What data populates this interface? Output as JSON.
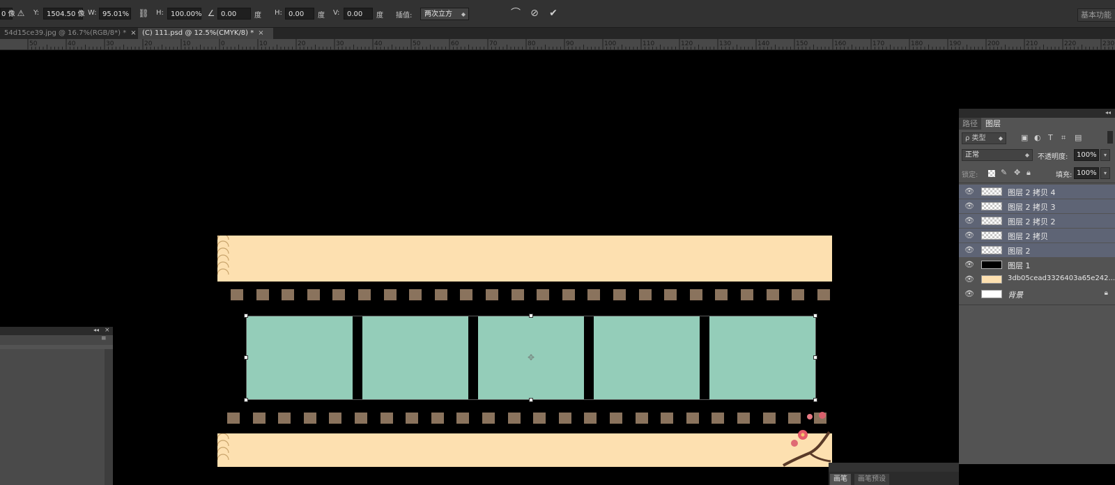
{
  "options_bar": {
    "x_partial": "0 像",
    "y_label": "Y:",
    "y_value": "1504.50 像",
    "w_label": "W:",
    "w_value": "95.01%",
    "h_label": "H:",
    "h_value": "100.00%",
    "angle_value": "0.00",
    "angle_unit": "度",
    "hskew_label": "H:",
    "hskew_value": "0.00",
    "hskew_unit": "度",
    "vskew_label": "V:",
    "vskew_value": "0.00",
    "vskew_unit": "度",
    "interp_label": "插值:",
    "interp_value": "两次立方",
    "workspace": "基本功能"
  },
  "tabs": [
    {
      "label": "54d15ce39.jpg @ 16.7%(RGB/8*) *",
      "active": false
    },
    {
      "label": "(C) 111.psd @ 12.5%(CMYK/8) *",
      "active": true
    }
  ],
  "ruler": {
    "labels": [
      "50",
      "40",
      "30",
      "20",
      "10",
      "0",
      "10",
      "20",
      "30",
      "40",
      "50",
      "60",
      "70",
      "80",
      "90",
      "100",
      "110",
      "120",
      "130",
      "140",
      "150",
      "160",
      "170",
      "180",
      "190",
      "200",
      "210",
      "220",
      "230"
    ]
  },
  "layers_panel": {
    "tabs": [
      "路径",
      "图层"
    ],
    "active_tab": "图层",
    "filter_label": "ρ 类型",
    "blend_mode": "正常",
    "opacity_label": "不透明度:",
    "opacity_value": "100%",
    "lock_label": "锁定:",
    "fill_label": "填充:",
    "fill_value": "100%",
    "layers": [
      {
        "name": "图层 2 拷贝 4",
        "selected": true,
        "thumb": "checker"
      },
      {
        "name": "图层 2 拷贝 3",
        "selected": true,
        "thumb": "checker"
      },
      {
        "name": "图层 2 拷贝 2",
        "selected": true,
        "thumb": "checker"
      },
      {
        "name": "图层 2 拷贝",
        "selected": true,
        "thumb": "checker"
      },
      {
        "name": "图层 2",
        "selected": true,
        "thumb": "checker"
      },
      {
        "name": "图层 1",
        "selected": false,
        "thumb": "film"
      },
      {
        "name": "3db05cead3326403a65e242...",
        "selected": false,
        "thumb": "peach"
      },
      {
        "name": "背景",
        "selected": false,
        "thumb": "white",
        "locked": true
      }
    ]
  },
  "brush_panel": {
    "tabs": [
      "画笔",
      "画笔预设"
    ]
  },
  "colors": {
    "ui_dark": "#323232",
    "panel": "#535353",
    "selected_layer": "#5e6475",
    "band": "#fde0b0",
    "frame": "#94cdb9",
    "sprocket": "#8a735d"
  }
}
